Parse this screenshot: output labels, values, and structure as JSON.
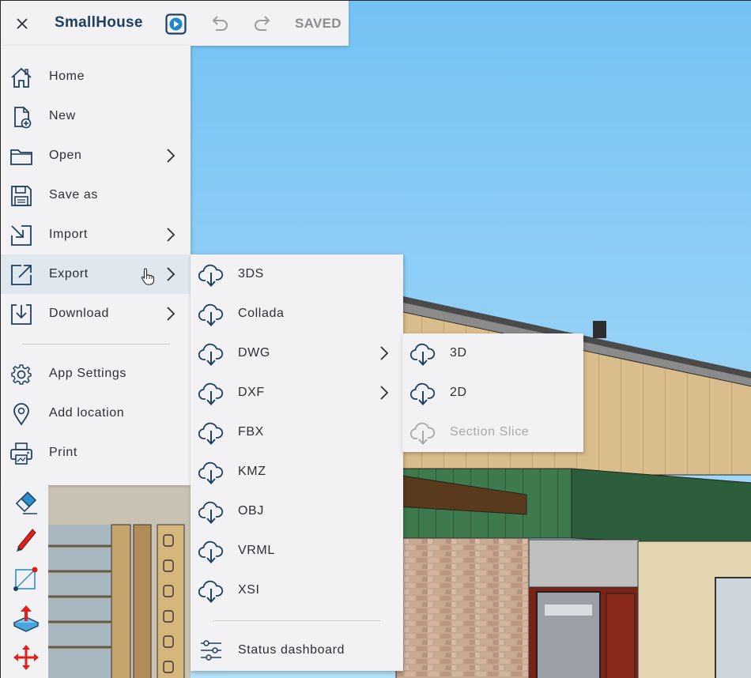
{
  "topbar": {
    "title": "SmallHouse",
    "saved_label": "SAVED"
  },
  "main_menu": {
    "items": [
      {
        "label": "Home",
        "icon": "home-icon"
      },
      {
        "label": "New",
        "icon": "new-file-icon"
      },
      {
        "label": "Open",
        "icon": "folder-icon",
        "has_submenu": true
      },
      {
        "label": "Save as",
        "icon": "save-icon"
      },
      {
        "label": "Import",
        "icon": "import-icon",
        "has_submenu": true
      },
      {
        "label": "Export",
        "icon": "export-icon",
        "has_submenu": true,
        "active": true
      },
      {
        "label": "Download",
        "icon": "download-icon",
        "has_submenu": true
      },
      {
        "label": "App Settings",
        "icon": "gear-icon"
      },
      {
        "label": "Add location",
        "icon": "location-pin-icon"
      },
      {
        "label": "Print",
        "icon": "printer-icon"
      }
    ]
  },
  "export_menu": {
    "items": [
      {
        "label": "3DS",
        "icon": "cloud-download-icon"
      },
      {
        "label": "Collada",
        "icon": "cloud-download-icon"
      },
      {
        "label": "DWG",
        "icon": "cloud-download-icon",
        "has_submenu": true
      },
      {
        "label": "DXF",
        "icon": "cloud-download-icon",
        "has_submenu": true
      },
      {
        "label": "FBX",
        "icon": "cloud-download-icon"
      },
      {
        "label": "KMZ",
        "icon": "cloud-download-icon"
      },
      {
        "label": "OBJ",
        "icon": "cloud-download-icon"
      },
      {
        "label": "VRML",
        "icon": "cloud-download-icon"
      },
      {
        "label": "XSI",
        "icon": "cloud-download-icon"
      }
    ],
    "footer": {
      "label": "Status dashboard",
      "icon": "sliders-icon"
    }
  },
  "dwg_menu": {
    "items": [
      {
        "label": "3D",
        "icon": "cloud-download-icon"
      },
      {
        "label": "2D",
        "icon": "cloud-download-icon"
      },
      {
        "label": "Section Slice",
        "icon": "cloud-download-icon",
        "disabled": true
      }
    ]
  },
  "tools": [
    "eraser-icon",
    "pencil-icon",
    "rectangle-tool-icon",
    "push-pull-icon",
    "move-icon"
  ],
  "colors": {
    "menu_bg": "#f2f2f4",
    "active_bg": "#dfe7ef",
    "icon_dark": "#1f3f60",
    "accent_blue": "#1e88c8",
    "text": "#2b2f36",
    "disabled_text": "#a5a9ae",
    "tool_red": "#e0201b"
  }
}
